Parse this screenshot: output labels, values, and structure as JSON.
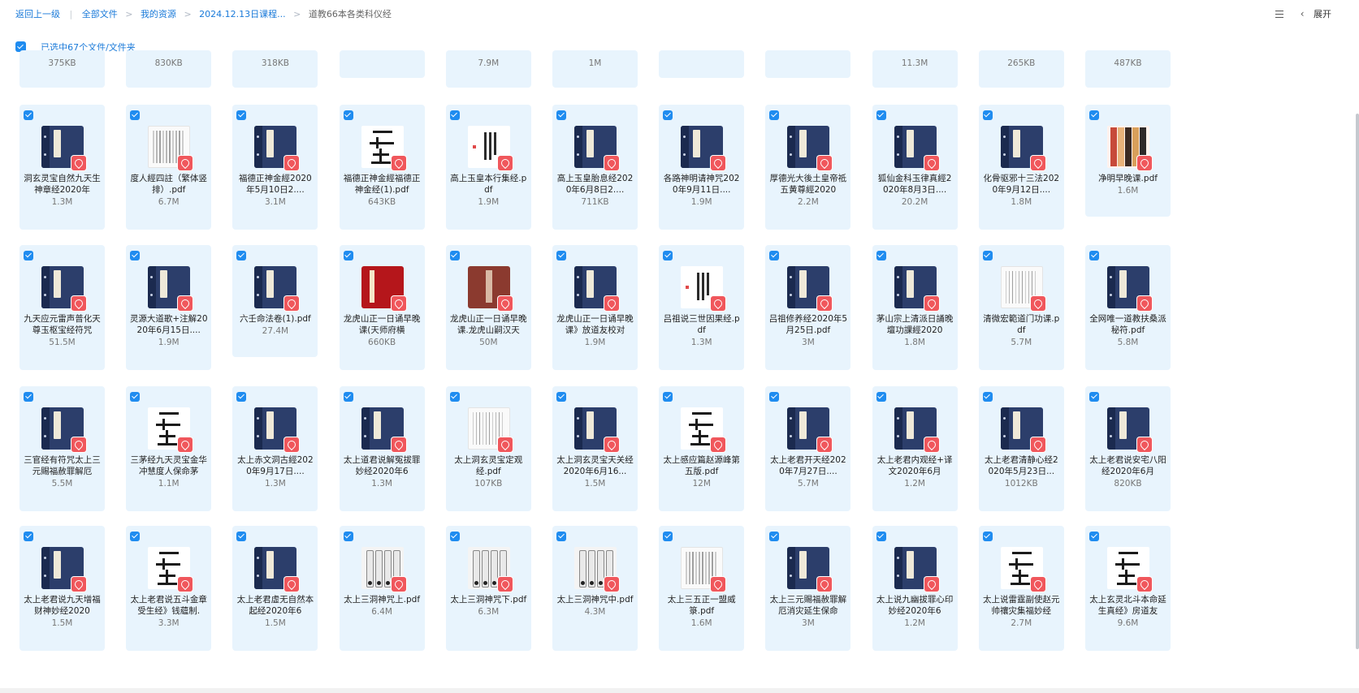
{
  "breadcrumb": {
    "back": "返回上一级",
    "items": [
      "全部文件",
      "我的资源",
      "2024.12.13日课程...",
      "道教66本各类科仪经"
    ]
  },
  "toolbar": {
    "expand": "展开"
  },
  "selection": {
    "text": "已选中67个文件/文件夹"
  },
  "partial_sizes": [
    "375KB",
    "830KB",
    "318KB",
    "",
    "7.9M",
    "1M",
    "",
    "",
    "11.3M",
    "265KB",
    "487KB"
  ],
  "files": [
    {
      "name": "洞玄灵宝自然九天生神章经2020年",
      "size": "1.3M",
      "thumb": "book"
    },
    {
      "name": "度人經四註（繁体竖排）.pdf",
      "size": "6.7M",
      "thumb": "page"
    },
    {
      "name": "福德正神金經2020年5月10日2....",
      "size": "3.1M",
      "thumb": "book"
    },
    {
      "name": "福德正神金經福德正神金经(1).pdf",
      "size": "643KB",
      "thumb": "ink"
    },
    {
      "name": "高上玉皇本行集经.pdf",
      "size": "1.9M",
      "thumb": "mini"
    },
    {
      "name": "高上玉皇胎息经2020年6月8日2....",
      "size": "711KB",
      "thumb": "book"
    },
    {
      "name": "各路神明请神咒2020年9月11日....",
      "size": "1.9M",
      "thumb": "book"
    },
    {
      "name": "厚德光大後土皇帝祗五黄尊經2020",
      "size": "2.2M",
      "thumb": "book"
    },
    {
      "name": "狐仙金科玉律真經2020年8月3日....",
      "size": "20.2M",
      "thumb": "book"
    },
    {
      "name": "化骨驱邪十三法2020年9月12日....",
      "size": "1.8M",
      "thumb": "book"
    },
    {
      "name": "净明早晚课.pdf",
      "size": "1.6M",
      "thumb": "colored"
    },
    {
      "name": "九天应元雷声普化天尊玉枢宝经符咒",
      "size": "51.5M",
      "thumb": "book"
    },
    {
      "name": "灵源大道歌+注解2020年6月15日....",
      "size": "1.9M",
      "thumb": "book"
    },
    {
      "name": "六壬命法卷(1).pdf",
      "size": "27.4M",
      "thumb": "book"
    },
    {
      "name": "龙虎山正一日诵早晚课(天师府横",
      "size": "660KB",
      "thumb": "redbook"
    },
    {
      "name": "龙虎山正一日诵早晚课.龙虎山嗣汉天",
      "size": "50M",
      "thumb": "brownbook"
    },
    {
      "name": "龙虎山正一日诵早晚课》放道友校对",
      "size": "1.9M",
      "thumb": "book"
    },
    {
      "name": "吕祖说三世因果经.pdf",
      "size": "1.3M",
      "thumb": "mini"
    },
    {
      "name": "吕祖修养经2020年5月25日.pdf",
      "size": "3M",
      "thumb": "book"
    },
    {
      "name": "茅山宗上清派日誦晚壇功課經2020",
      "size": "1.8M",
      "thumb": "book"
    },
    {
      "name": "清微宏範道门功课.pdf",
      "size": "5.7M",
      "thumb": "page"
    },
    {
      "name": "全网唯一道教扶桑派秘符.pdf",
      "size": "5.8M",
      "thumb": "book"
    },
    {
      "name": "三官经有符咒太上三元賜福赦罪解厄",
      "size": "5.5M",
      "thumb": "book"
    },
    {
      "name": "三茅经九天灵宝金华冲慧度人保命茅",
      "size": "1.1M",
      "thumb": "ink"
    },
    {
      "name": "太上赤文洞古經2020年9月17日....",
      "size": "1.3M",
      "thumb": "book"
    },
    {
      "name": "太上道君说解冤拔罪妙经2020年6",
      "size": "1.3M",
      "thumb": "book"
    },
    {
      "name": "太上洞玄灵宝定观经.pdf",
      "size": "107KB",
      "thumb": "page"
    },
    {
      "name": "太上洞玄灵宝天关经2020年6月16...",
      "size": "1.5M",
      "thumb": "book"
    },
    {
      "name": "太上感应篇赵源峰第五版.pdf",
      "size": "12M",
      "thumb": "ink"
    },
    {
      "name": "太上老君开天经2020年7月27日....",
      "size": "5.7M",
      "thumb": "book"
    },
    {
      "name": "太上老君内观经+译文2020年6月",
      "size": "1.2M",
      "thumb": "book"
    },
    {
      "name": "太上老君清静心经2020年5月23日...",
      "size": "1012KB",
      "thumb": "book"
    },
    {
      "name": "太上老君说安宅八阳经2020年6月",
      "size": "820KB",
      "thumb": "book"
    },
    {
      "name": "太上老君说九天增福财神妙经2020",
      "size": "1.5M",
      "thumb": "book"
    },
    {
      "name": "太上老君说五斗金章受生经》钱蘊制.",
      "size": "3.3M",
      "thumb": "ink"
    },
    {
      "name": "太上老君虛无自然本起经2020年6",
      "size": "1.5M",
      "thumb": "book"
    },
    {
      "name": "太上三洞神咒上.pdf",
      "size": "6.4M",
      "thumb": "scroll"
    },
    {
      "name": "太上三洞神咒下.pdf",
      "size": "6.3M",
      "thumb": "scroll"
    },
    {
      "name": "太上三洞神咒中.pdf",
      "size": "4.3M",
      "thumb": "scroll"
    },
    {
      "name": "太上三五正一盟威箓.pdf",
      "size": "1.6M",
      "thumb": "page"
    },
    {
      "name": "太上三元賜福赦罪解厄消灾延生保命",
      "size": "3M",
      "thumb": "book"
    },
    {
      "name": "太上说九幽拔罪心印妙经2020年6",
      "size": "1.2M",
      "thumb": "book"
    },
    {
      "name": "太上说雷霆副使赵元帅禳灾集福妙经",
      "size": "2.7M",
      "thumb": "ink"
    },
    {
      "name": "太上玄灵北斗本命延生真经》房道友",
      "size": "9.6M",
      "thumb": "ink"
    }
  ],
  "colors": {
    "link": "#1a7ad9",
    "card_bg": "#e8f4fd",
    "checkbox": "#1f8cf0",
    "pdf_badge": "#f0575c"
  }
}
